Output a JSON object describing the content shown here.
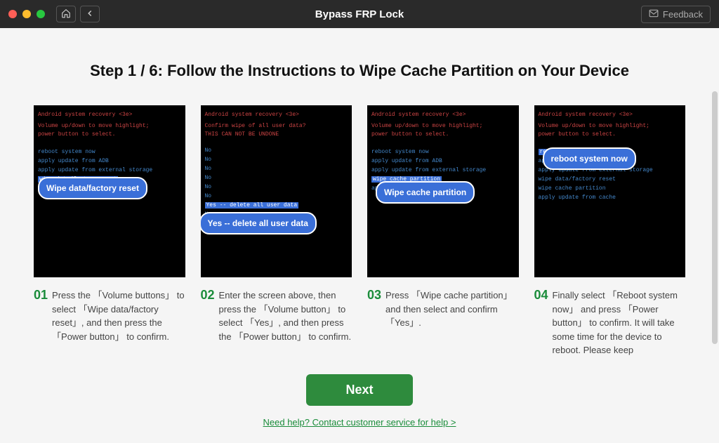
{
  "titlebar": {
    "title": "Bypass FRP Lock",
    "feedback": "Feedback"
  },
  "heading": "Step 1 / 6: Follow the Instructions to Wipe Cache Partition on Your Device",
  "recovery": {
    "header": "Android system recovery <3e>",
    "hint1": "Volume up/down to move highlight;",
    "hint2": "power button to select.",
    "confirm1": "Confirm wipe of all user data?",
    "confirm2": "  THIS CAN NOT BE UNDONE",
    "opts": {
      "reboot": "reboot system now",
      "adb": "apply update from ADB",
      "ext": "apply update from external storage",
      "wipedata": "wipe data/factory reset",
      "wipecache": "wipe cache partition",
      "cache": "apply update from cache",
      "no": "No",
      "yes": "Yes -- delete all user data"
    }
  },
  "callouts": {
    "s1": "Wipe data/factory reset",
    "s2": "Yes  --  delete all user data",
    "s3": "Wipe cache partition",
    "s4": "reboot system now"
  },
  "steps": [
    {
      "num": "01",
      "desc": "Press the 「Volume buttons」 to select 「Wipe data/factory reset」, and then press the 「Power button」 to confirm."
    },
    {
      "num": "02",
      "desc": "Enter the screen above, then press the 「Volume button」 to select 「Yes」, and then press the 「Power button」 to confirm."
    },
    {
      "num": "03",
      "desc": "Press 「Wipe cache partition」 and then select and confirm 「Yes」."
    },
    {
      "num": "04",
      "desc": "Finally select 「Reboot system now」 and press 「Power button」 to confirm.\nIt will take some time for the device to reboot. Please keep"
    }
  ],
  "footer": {
    "next": "Next",
    "help": "Need help? Contact customer service for help >"
  }
}
